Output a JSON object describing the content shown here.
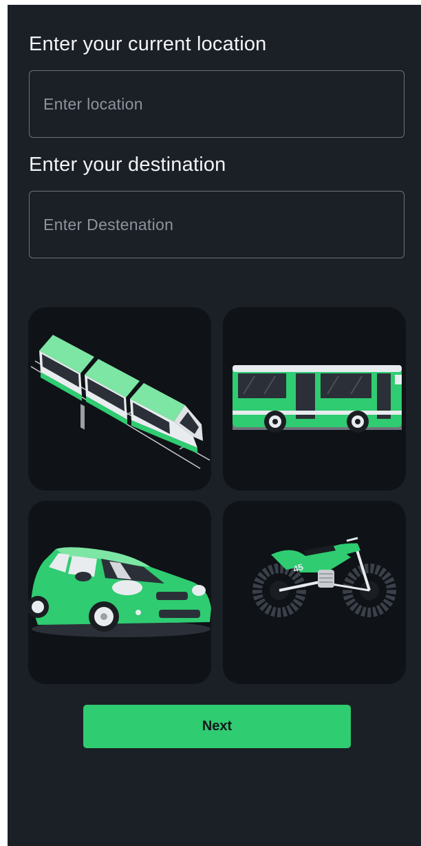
{
  "location": {
    "heading": "Enter your current location",
    "placeholder": "Enter location",
    "value": ""
  },
  "destination": {
    "heading": "Enter your destination",
    "placeholder": "Enter Destenation",
    "value": ""
  },
  "transport_options": [
    {
      "id": "tram",
      "icon": "tram-icon"
    },
    {
      "id": "bus",
      "icon": "bus-icon"
    },
    {
      "id": "car",
      "icon": "car-icon"
    },
    {
      "id": "motorbike",
      "icon": "motorbike-icon",
      "number": "45"
    }
  ],
  "actions": {
    "next_label": "Next"
  },
  "colors": {
    "background": "#1b1f26",
    "tile": "#0f1216",
    "accent": "#2fcc71",
    "text": "#f2f4f7",
    "placeholder": "#8d939c",
    "border": "#6b717b"
  }
}
